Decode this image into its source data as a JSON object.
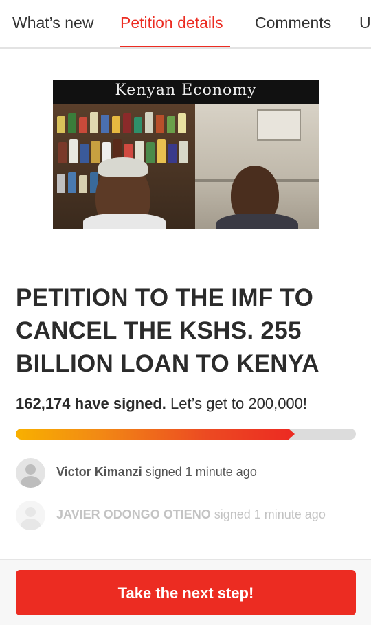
{
  "tabs": [
    {
      "label": "What’s new",
      "active": false
    },
    {
      "label": "Petition details",
      "active": true
    },
    {
      "label": "Comments",
      "active": false
    },
    {
      "label": "U",
      "active": false
    }
  ],
  "hero": {
    "caption": "Kenyan Economy"
  },
  "petition": {
    "title": "PETITION TO THE IMF TO CANCEL THE KSHS. 255 BILLION LOAN TO KENYA",
    "signed_count": "162,174 have signed.",
    "goal_text": "Let’s get to 200,000!",
    "progress_fraction": 0.82
  },
  "signers": [
    {
      "name": "Victor Kimanzi",
      "action": "signed 1 minute ago"
    },
    {
      "name": "JAVIER ODONGO OTIENO",
      "action": "signed 1 minute ago"
    }
  ],
  "footer": {
    "cta_label": "Take the next step!"
  },
  "colors": {
    "accent": "#ec2c22",
    "progress_start": "#f8b000",
    "track": "#dcdcdc"
  }
}
